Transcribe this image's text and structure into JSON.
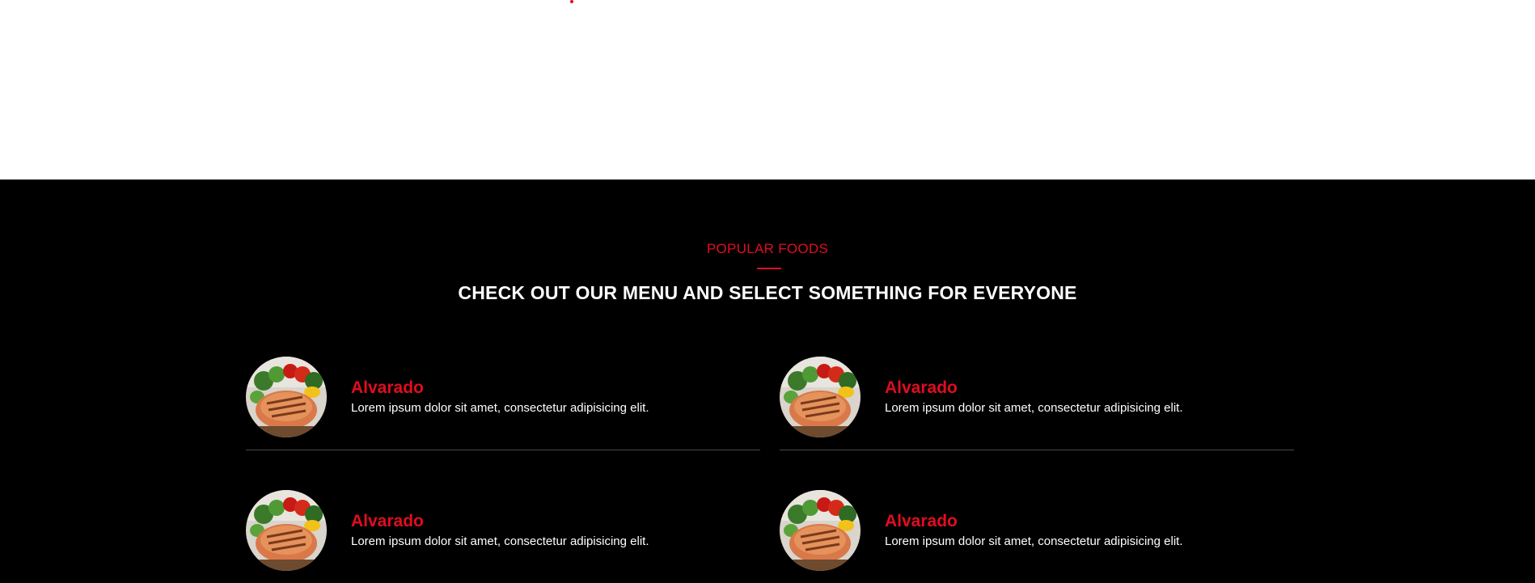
{
  "section": {
    "eyebrow": "POPULAR FOODS",
    "title": "CHECK OUT OUR MENU AND SELECT SOMETHING FOR EVERYONE"
  },
  "colors": {
    "accent": "#e10d1f",
    "background": "#000000",
    "divider": "#4a4a4a"
  },
  "menu_items": [
    {
      "name": "Alvarado",
      "description": "Lorem ipsum dolor sit amet, consectetur adipisicing elit.",
      "image": "grilled-salmon-dish"
    },
    {
      "name": "Alvarado",
      "description": "Lorem ipsum dolor sit amet, consectetur adipisicing elit.",
      "image": "grilled-salmon-dish"
    },
    {
      "name": "Alvarado",
      "description": "Lorem ipsum dolor sit amet, consectetur adipisicing elit.",
      "image": "grilled-salmon-dish"
    },
    {
      "name": "Alvarado",
      "description": "Lorem ipsum dolor sit amet, consectetur adipisicing elit.",
      "image": "grilled-salmon-dish"
    }
  ]
}
